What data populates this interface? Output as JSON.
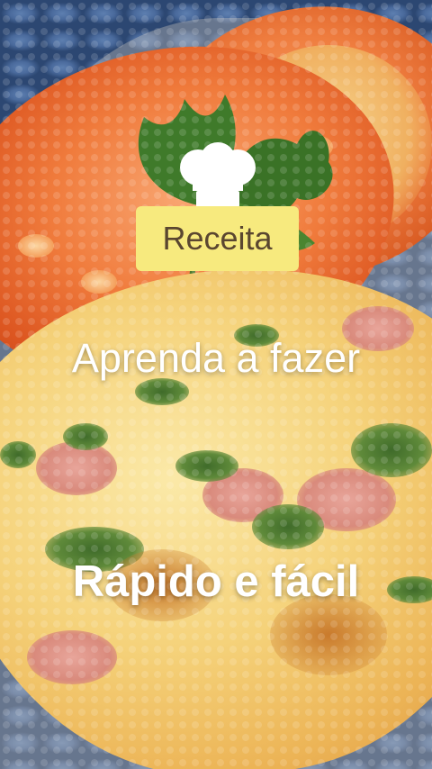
{
  "badge": {
    "label": "Receita",
    "background": "#f7ea7e",
    "text_color": "#5a4630",
    "icon": "chef-hat-icon"
  },
  "headline_top": "Aprenda a fazer",
  "headline_bottom": "Rápido e fácil"
}
